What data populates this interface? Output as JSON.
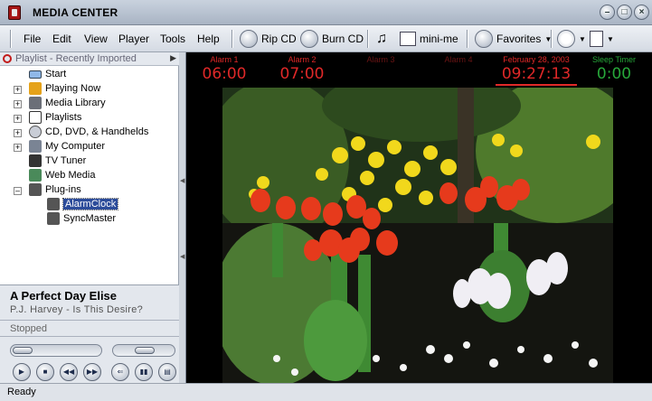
{
  "window": {
    "title": "MEDIA CENTER"
  },
  "menu": [
    "File",
    "Edit",
    "View",
    "Player",
    "Tools",
    "Help"
  ],
  "toolbar": {
    "rip_cd": "Rip CD",
    "burn_cd": "Burn CD",
    "mini_me": "mini-me",
    "favorites": "Favorites"
  },
  "list_header": "Playlist - Recently Imported",
  "tree": {
    "start": "Start",
    "playing_now": "Playing Now",
    "media_library": "Media Library",
    "playlists": "Playlists",
    "cd_dvd": "CD, DVD, & Handhelds",
    "my_computer": "My Computer",
    "tv_tuner": "TV Tuner",
    "web_media": "Web Media",
    "plugins": "Plug-ins",
    "alarm_clock": "AlarmClock",
    "sync_master": "SyncMaster"
  },
  "now_playing": {
    "title": "A Perfect Day Elise",
    "artist": "P.J. Harvey - Is This Desire?",
    "status": "Stopped"
  },
  "alarms": [
    {
      "label": "Alarm 1",
      "value": "06:00"
    },
    {
      "label": "Alarm 2",
      "value": "07:00"
    },
    {
      "label": "Alarm 3",
      "value": ""
    },
    {
      "label": "Alarm 4",
      "value": ""
    }
  ],
  "clock": {
    "date": "February 28, 2003",
    "time": "09:27:13"
  },
  "sleep_timer": {
    "label": "Sleep Timer",
    "value": "0:00"
  },
  "status_bar": "Ready",
  "colors": {
    "alarm_active": "#e02828",
    "alarm_inactive": "#6a1414",
    "sleep": "#27a83a",
    "selection": "#2c4c9a"
  }
}
